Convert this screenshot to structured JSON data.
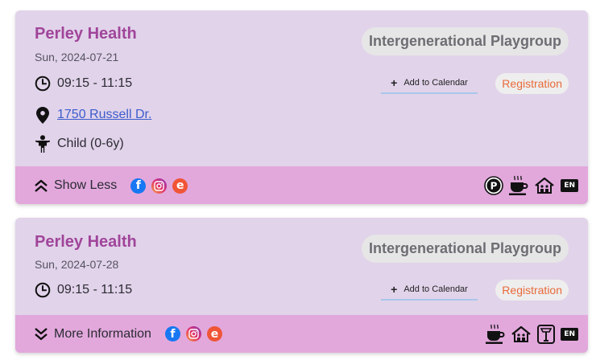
{
  "events": [
    {
      "org": "Perley Health",
      "date": "Sun, 2024-07-21",
      "title": "Intergenerational Playgroup",
      "time": "09:15 - 11:15",
      "location": "1750 Russell Dr.",
      "age": "Child (0-6y)",
      "add_to_calendar": "Add to Calendar",
      "registration": "Registration",
      "toggle_label": "Show Less",
      "toggle_icon": "chevron-double-up-icon",
      "socials": [
        "facebook-icon",
        "instagram-icon",
        "eventbrite-icon"
      ],
      "amenities": [
        "parking-icon",
        "coffee-icon",
        "home-icon",
        "english-badge"
      ],
      "amenity_en": "EN"
    },
    {
      "org": "Perley Health",
      "date": "Sun, 2024-07-28",
      "title": "Intergenerational Playgroup",
      "time": "09:15 - 11:15",
      "add_to_calendar": "Add to Calendar",
      "registration": "Registration",
      "toggle_label": "More Information",
      "toggle_icon": "chevron-double-down-icon",
      "socials": [
        "facebook-icon",
        "instagram-icon",
        "eventbrite-icon"
      ],
      "amenities": [
        "coffee-icon",
        "home-icon",
        "scale-icon",
        "english-badge"
      ],
      "amenity_en": "EN"
    }
  ],
  "colors": {
    "card_bg": "#e1d3ea",
    "footer_bg": "#e2a8dc",
    "org_title": "#a0459a",
    "registration": "#e86a3a",
    "link": "#3b5ccc"
  }
}
